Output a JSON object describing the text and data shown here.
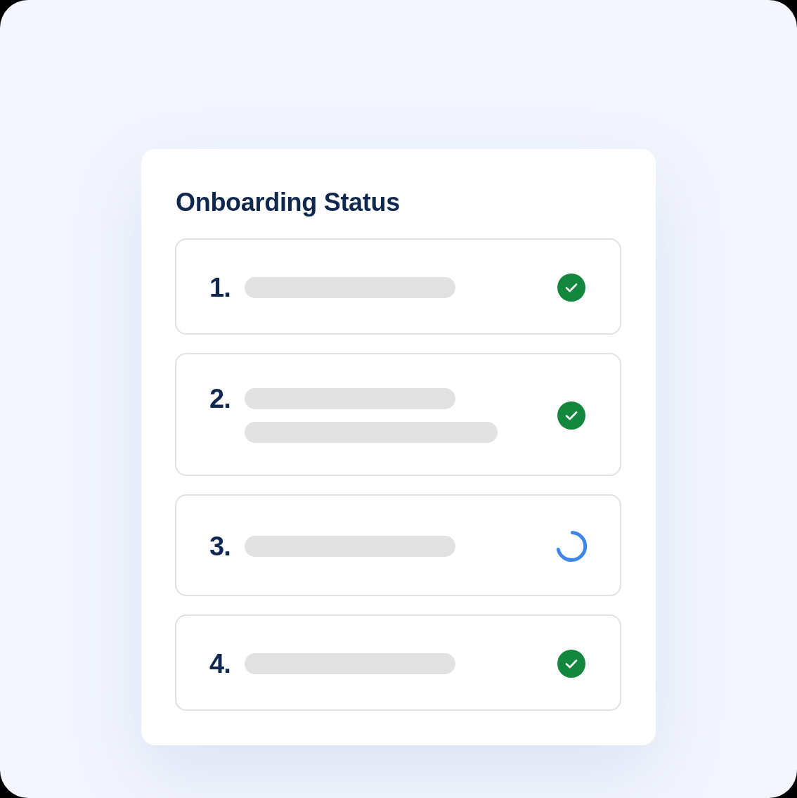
{
  "card": {
    "title": "Onboarding Status",
    "steps": [
      {
        "number": "1.",
        "lines": [
          {
            "kind": "short"
          }
        ],
        "completed": true
      },
      {
        "number": "2.",
        "lines": [
          {
            "kind": "short"
          },
          {
            "kind": "long"
          }
        ],
        "completed": true
      },
      {
        "number": "3.",
        "lines": [
          {
            "kind": "short"
          }
        ],
        "completed": false
      },
      {
        "number": "4.",
        "lines": [
          {
            "kind": "short"
          }
        ],
        "completed": true
      }
    ]
  }
}
